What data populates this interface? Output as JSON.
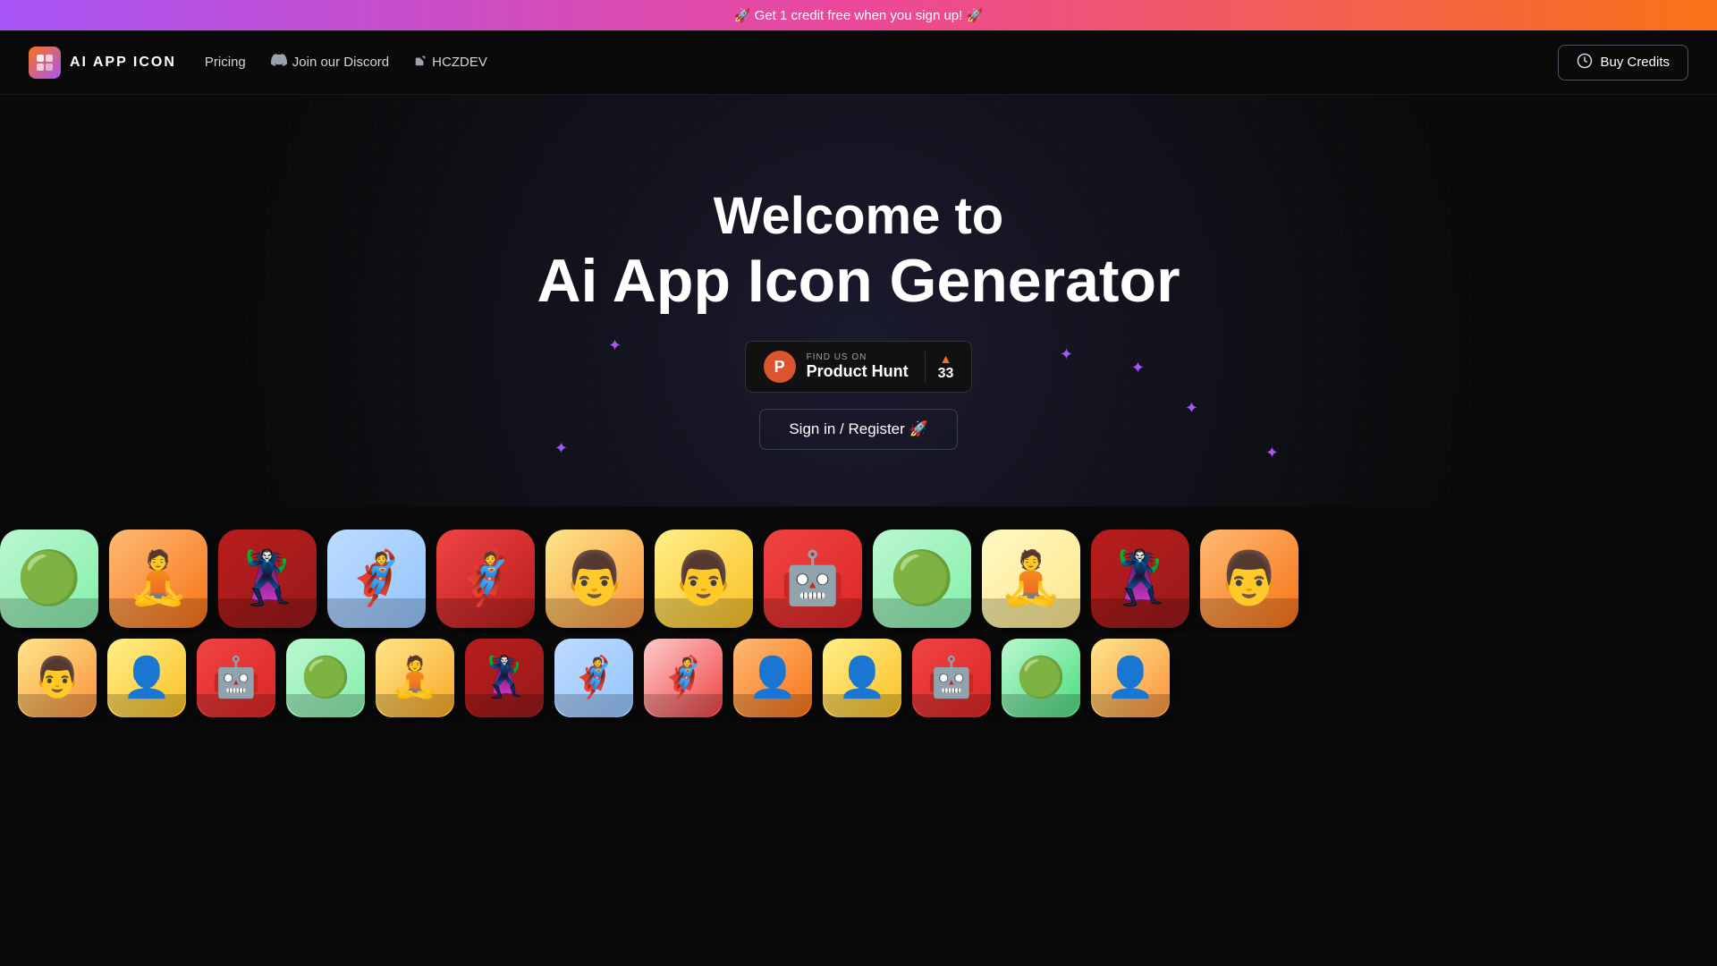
{
  "banner": {
    "text": "🚀 Get 1 credit free when you sign up! 🚀"
  },
  "navbar": {
    "logo_text": "AI APP ICON",
    "logo_emoji": "🎨",
    "links": [
      {
        "label": "Pricing",
        "icon": ""
      },
      {
        "label": "Join our Discord",
        "icon": "💬"
      },
      {
        "label": "HCZDEV",
        "icon": "↗"
      }
    ],
    "buy_credits_label": "Buy Credits",
    "credits_icon": "🪙"
  },
  "hero": {
    "title_line1": "Welcome to",
    "title_line2": "Ai App Icon Generator",
    "product_hunt": {
      "find_us": "FIND US ON",
      "name": "Product Hunt",
      "count": "33"
    },
    "signin_label": "Sign in / Register 🚀"
  },
  "icons": {
    "row1": [
      {
        "bg": "bg-green-light",
        "char": "🦸",
        "label": "hulk-1"
      },
      {
        "bg": "bg-orange",
        "char": "🧘",
        "label": "yoga-1"
      },
      {
        "bg": "bg-red-dark",
        "char": "🦸",
        "label": "hulk-2"
      },
      {
        "bg": "bg-blue-light",
        "char": "🦸",
        "label": "superman-1"
      },
      {
        "bg": "bg-orange",
        "char": "🦸",
        "label": "superman-2"
      },
      {
        "bg": "bg-orange-warm",
        "char": "👤",
        "label": "person-1"
      },
      {
        "bg": "bg-yellow",
        "char": "👤",
        "label": "person-2"
      },
      {
        "bg": "bg-red",
        "char": "🤖",
        "label": "ironman-1"
      },
      {
        "bg": "bg-green-light",
        "char": "🦸",
        "label": "hulk-3"
      },
      {
        "bg": "bg-cream",
        "char": "🧘",
        "label": "yoga-2"
      },
      {
        "bg": "bg-red-dark",
        "char": "🦸",
        "label": "hulk-4"
      }
    ],
    "row2": [
      {
        "bg": "bg-orange-warm",
        "char": "👤",
        "label": "person-3"
      },
      {
        "bg": "bg-yellow",
        "char": "👤",
        "label": "person-4"
      },
      {
        "bg": "bg-red",
        "char": "🤖",
        "label": "ironman-2"
      },
      {
        "bg": "bg-green-light",
        "char": "🦸",
        "label": "hulk-5"
      },
      {
        "bg": "bg-orange2",
        "char": "🧘",
        "label": "yoga-3"
      },
      {
        "bg": "bg-red-dark",
        "char": "🦸",
        "label": "hulk-6"
      },
      {
        "bg": "bg-blue-light",
        "char": "🦸",
        "label": "superman-3"
      },
      {
        "bg": "bg-salmon",
        "char": "🦸",
        "label": "superman-4"
      },
      {
        "bg": "bg-orange",
        "char": "👤",
        "label": "person-5"
      },
      {
        "bg": "bg-yellow",
        "char": "👤",
        "label": "person-6"
      },
      {
        "bg": "bg-red",
        "char": "🤖",
        "label": "ironman-3"
      },
      {
        "bg": "bg-green2",
        "char": "🦸",
        "label": "hulk-7"
      }
    ]
  }
}
